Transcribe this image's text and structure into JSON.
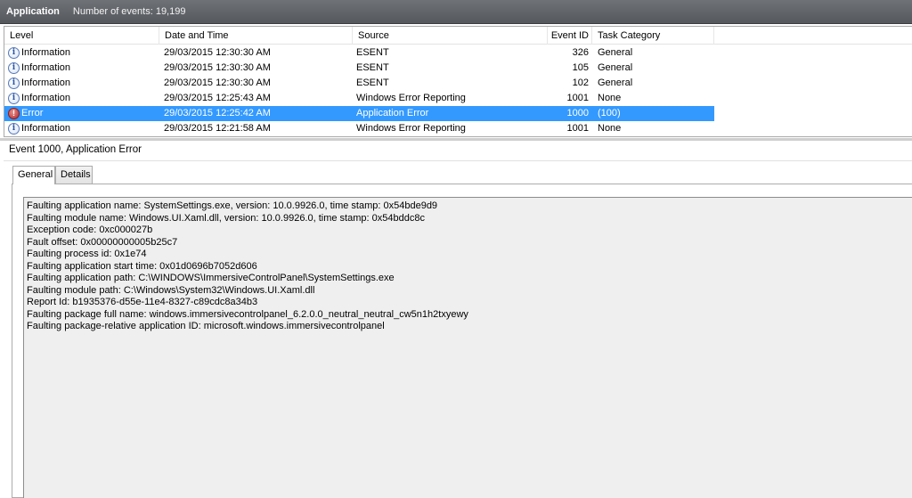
{
  "header": {
    "title": "Application",
    "event_count": "Number of events: 19,199"
  },
  "columns": {
    "level": "Level",
    "date": "Date and Time",
    "source": "Source",
    "event_id": "Event ID",
    "category": "Task Category"
  },
  "events": [
    {
      "level": "Information",
      "date": "29/03/2015 12:30:30 AM",
      "source": "ESENT",
      "event_id": "326",
      "category": "General",
      "icon": "information-icon"
    },
    {
      "level": "Information",
      "date": "29/03/2015 12:30:30 AM",
      "source": "ESENT",
      "event_id": "105",
      "category": "General",
      "icon": "information-icon"
    },
    {
      "level": "Information",
      "date": "29/03/2015 12:30:30 AM",
      "source": "ESENT",
      "event_id": "102",
      "category": "General",
      "icon": "information-icon"
    },
    {
      "level": "Information",
      "date": "29/03/2015 12:25:43 AM",
      "source": "Windows Error Reporting",
      "event_id": "1001",
      "category": "None",
      "icon": "information-icon"
    },
    {
      "level": "Error",
      "date": "29/03/2015 12:25:42 AM",
      "source": "Application Error",
      "event_id": "1000",
      "category": "(100)",
      "icon": "error-icon",
      "selected": true
    },
    {
      "level": "Information",
      "date": "29/03/2015 12:21:58 AM",
      "source": "Windows Error Reporting",
      "event_id": "1001",
      "category": "None",
      "icon": "information-icon"
    }
  ],
  "detail": {
    "title": "Event 1000, Application Error",
    "tabs": [
      "General",
      "Details"
    ],
    "active_tab": "General",
    "lines": [
      "Faulting application name: SystemSettings.exe, version: 10.0.9926.0, time stamp: 0x54bde9d9",
      "Faulting module name: Windows.UI.Xaml.dll, version: 10.0.9926.0, time stamp: 0x54bddc8c",
      "Exception code: 0xc000027b",
      "Fault offset: 0x00000000005b25c7",
      "Faulting process id: 0x1e74",
      "Faulting application start time: 0x01d0696b7052d606",
      "Faulting application path: C:\\WINDOWS\\ImmersiveControlPanel\\SystemSettings.exe",
      "Faulting module path: C:\\Windows\\System32\\Windows.UI.Xaml.dll",
      "Report Id: b1935376-d55e-11e4-8327-c89cdc8a34b3",
      "Faulting package full name: windows.immersivecontrolpanel_6.2.0.0_neutral_neutral_cw5n1h2txyewy",
      "Faulting package-relative application ID: microsoft.windows.immersivecontrolpanel"
    ]
  },
  "colors": {
    "selection": "#3399ff",
    "header_bg": "#5f6266",
    "detail_box": "#efefef"
  }
}
